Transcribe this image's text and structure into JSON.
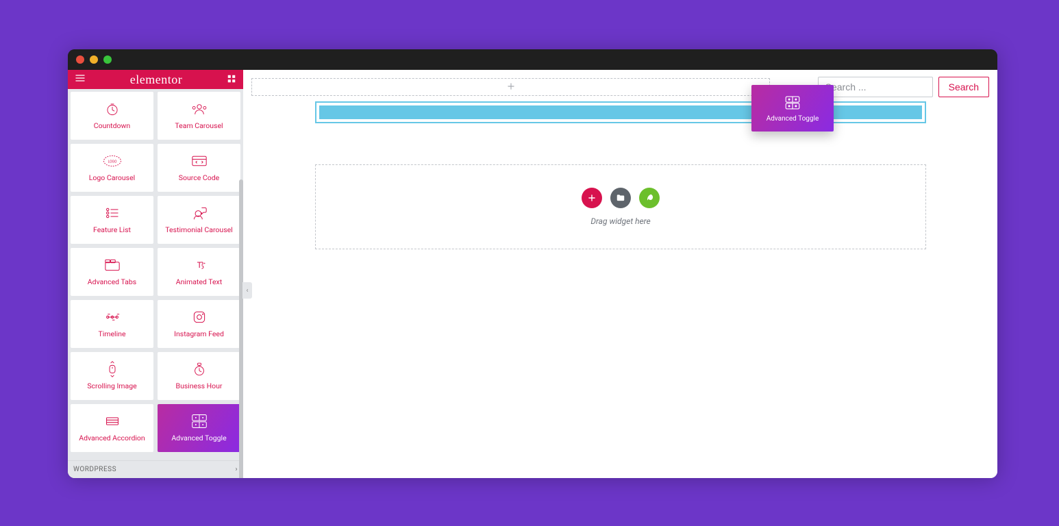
{
  "app": {
    "title": "elementor"
  },
  "search": {
    "placeholder": "Search ...",
    "button_label": "Search"
  },
  "sidebar": {
    "section_label": "WORDPRESS",
    "widgets": [
      {
        "label": "Countdown",
        "icon": "countdown-icon",
        "selected": false
      },
      {
        "label": "Team Carousel",
        "icon": "team-icon",
        "selected": false
      },
      {
        "label": "Logo Carousel",
        "icon": "logo-icon",
        "selected": false
      },
      {
        "label": "Source Code",
        "icon": "code-icon",
        "selected": false
      },
      {
        "label": "Feature List",
        "icon": "list-icon",
        "selected": false
      },
      {
        "label": "Testimonial Carousel",
        "icon": "testimonial-icon",
        "selected": false
      },
      {
        "label": "Advanced Tabs",
        "icon": "tabs-icon",
        "selected": false
      },
      {
        "label": "Animated Text",
        "icon": "animated-text-icon",
        "selected": false
      },
      {
        "label": "Timeline",
        "icon": "timeline-icon",
        "selected": false
      },
      {
        "label": "Instagram Feed",
        "icon": "instagram-icon",
        "selected": false
      },
      {
        "label": "Scrolling Image",
        "icon": "scroll-image-icon",
        "selected": false
      },
      {
        "label": "Business Hour",
        "icon": "business-hour-icon",
        "selected": false
      },
      {
        "label": "Advanced Accordion",
        "icon": "accordion-icon",
        "selected": false
      },
      {
        "label": "Advanced Toggle",
        "icon": "toggle-icon",
        "selected": true
      }
    ]
  },
  "canvas": {
    "drag_hint": "Drag widget here",
    "dragging_label": "Advanced Toggle"
  }
}
